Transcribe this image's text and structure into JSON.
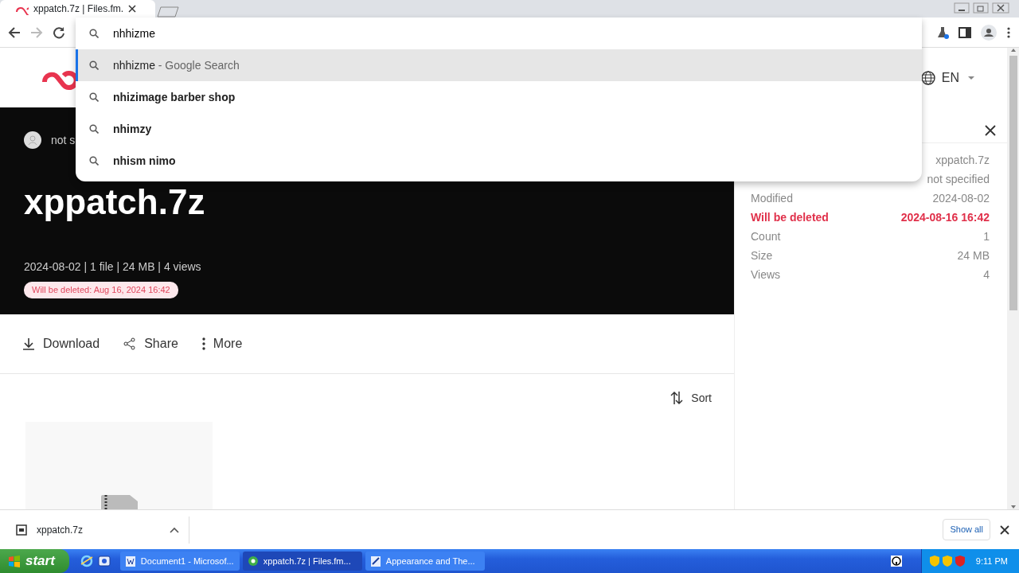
{
  "browser": {
    "tab": {
      "title": "xppatch.7z | Files.fm."
    },
    "address": {
      "value": "nhhizme"
    },
    "suggestions": [
      {
        "text": "nhhizme",
        "suffix": " - Google Search",
        "selected": true
      },
      {
        "text": "nhizimage barber shop",
        "selected": false
      },
      {
        "text": "nhimzy",
        "selected": false
      },
      {
        "text": "nhism nimo",
        "selected": false
      }
    ]
  },
  "header": {
    "language": "EN"
  },
  "hero": {
    "user": "not s",
    "title": "xppatch.7z",
    "meta": "2024-08-02 | 1 file | 24 MB | 4 views",
    "deletion_badge": "Will be deleted: Aug 16, 2024 16:42"
  },
  "actions": [
    {
      "label": "Download",
      "kind": "download"
    },
    {
      "label": "Share",
      "kind": "share"
    },
    {
      "label": "More",
      "kind": "more"
    }
  ],
  "sort": {
    "label": "Sort"
  },
  "info_panel": {
    "rows": [
      {
        "value": "xppatch.7z",
        "kind": "normal"
      },
      {
        "value": "not specified",
        "kind": "normal"
      },
      {
        "label": "Modified",
        "value": "2024-08-02",
        "kind": "normal"
      },
      {
        "label": "Will be deleted",
        "value": "2024-08-16 16:42",
        "kind": "warning"
      },
      {
        "label": "Count",
        "value": "1",
        "kind": "normal"
      },
      {
        "label": "Size",
        "value": "24 MB",
        "kind": "normal"
      },
      {
        "label": "Views",
        "value": "4",
        "kind": "normal"
      }
    ]
  },
  "download_bar": {
    "file": "xppatch.7z",
    "show_all": "Show all"
  },
  "taskbar": {
    "start": "start",
    "items": [
      {
        "label": "Document1 - Microsof...",
        "kind": "word",
        "selected": false
      },
      {
        "label": "xppatch.7z | Files.fm...",
        "kind": "browser",
        "selected": true
      },
      {
        "label": "Appearance and The...",
        "kind": "panel",
        "selected": false
      }
    ],
    "clock": "9:11 PM"
  }
}
